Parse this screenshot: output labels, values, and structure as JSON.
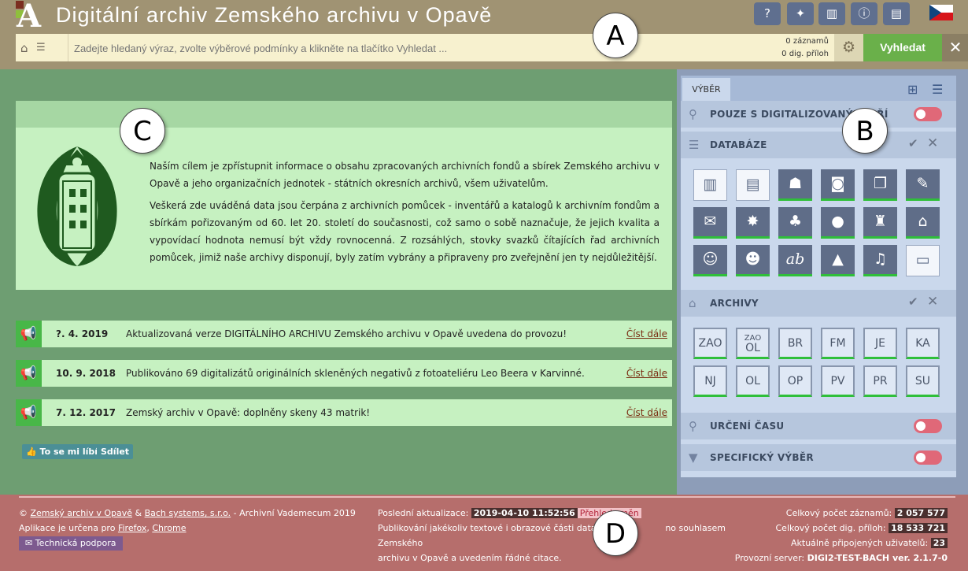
{
  "app": {
    "title": "Digitální archiv Zemského archivu v Opavě",
    "logo_letter": "A"
  },
  "toolbar": {
    "icons": [
      "help-icon",
      "magic-wand-icon",
      "chart-icon",
      "info-icon",
      "print-icon"
    ],
    "language": "cs"
  },
  "search": {
    "placeholder": "Zadejte hledaný výraz, zvolte výběrové podmínky a klikněte na tlačítko Vyhledat ...",
    "records_count": "0 záznamů",
    "attachments_count": "0 dig. příloh",
    "search_label": "Vyhledat"
  },
  "intro": {
    "p1": "Naším cílem je zpřístupnit informace o obsahu zpracovaných archivních fondů a sbírek Zemského archivu v Opavě a jeho organizačních jednotek - státních okresních archivů, všem uživatelům.",
    "p2": "Veškerá zde uváděná data jsou čerpána z archivních pomůcek - inventářů a katalogů k archivním fondům a sbírkám pořizovaným od 60. let 20. století do současnosti, což samo o sobě naznačuje, že jejich kvalita a vypovídací hodnota nemusí být vždy rovnocenná. Z rozsáhlých, stovky svazků čítajících řad archivních pomůcek, jimiž naše archivy disponují, byly zatím vybrány a připraveny pro zveřejnění jen ty nejdůležitější."
  },
  "news": [
    {
      "date": "?. 4. 2019",
      "text": "Aktualizovaná verze DIGITÁLNÍHO ARCHIVU Zemského archivu v Opavě uvedena do provozu!",
      "more": "Číst dále"
    },
    {
      "date": "10. 9. 2018",
      "text": "Publikováno 69 digitalizátů originálních skleněných negativů z fotoateliéru Leo Beera v Karvinné.",
      "more": "Číst dále"
    },
    {
      "date": "7. 12. 2017",
      "text": "Zemský archiv v Opavě: doplněny skeny 43 matrik!",
      "more": "Číst dále"
    }
  ],
  "social": {
    "like": "To se mi líbí",
    "share": "Sdílet"
  },
  "panel": {
    "tab": "VÝBĚR",
    "digitized_only": "POUZE S DIGITALIZOVANÝMI PŘÍ",
    "databases": "DATABÁZE",
    "archives": "ARCHIVY",
    "time": "URČENÍ ČASU",
    "specific": "SPECIFICKÝ VÝBĚR"
  },
  "db_icons": [
    {
      "name": "archive-fonds-icon",
      "glyph": "▥",
      "state": "off",
      "style": "light"
    },
    {
      "name": "inventory-icon",
      "glyph": "▤",
      "state": "off",
      "style": "light"
    },
    {
      "name": "person-reader-icon",
      "glyph": "☗",
      "state": "on",
      "style": "dark"
    },
    {
      "name": "camera-icon",
      "glyph": "◙",
      "state": "on",
      "style": "dark"
    },
    {
      "name": "documents-icon",
      "glyph": "❐",
      "state": "on",
      "style": "dark"
    },
    {
      "name": "feather-icon",
      "glyph": "✎",
      "state": "on",
      "style": "dark"
    },
    {
      "name": "scroll-icon",
      "glyph": "✉",
      "state": "on",
      "style": "dark"
    },
    {
      "name": "star-icon",
      "glyph": "✸",
      "state": "on",
      "style": "dark"
    },
    {
      "name": "tree-icon",
      "glyph": "♣",
      "state": "on",
      "style": "dark"
    },
    {
      "name": "seal-icon",
      "glyph": "●",
      "state": "on",
      "style": "dark"
    },
    {
      "name": "stamp-icon",
      "glyph": "♜",
      "state": "on",
      "style": "dark"
    },
    {
      "name": "house-icon",
      "glyph": "⌂",
      "state": "on",
      "style": "dark"
    },
    {
      "name": "portrait-icon",
      "glyph": "☺",
      "state": "on",
      "style": "dark"
    },
    {
      "name": "people-icon",
      "glyph": "☻",
      "state": "on",
      "style": "dark"
    },
    {
      "name": "handwriting-icon",
      "glyph": "ab",
      "state": "on",
      "style": "dark"
    },
    {
      "name": "map-icon",
      "glyph": "▲",
      "state": "on",
      "style": "dark"
    },
    {
      "name": "film-icon",
      "glyph": "♫",
      "state": "on",
      "style": "dark"
    },
    {
      "name": "book-icon",
      "glyph": "▭",
      "state": "off",
      "style": "light"
    }
  ],
  "archives": [
    {
      "top": "ZAO",
      "bottom": ""
    },
    {
      "top": "ZAO",
      "bottom": "OL"
    },
    {
      "top": "BR",
      "bottom": ""
    },
    {
      "top": "FM",
      "bottom": ""
    },
    {
      "top": "JE",
      "bottom": ""
    },
    {
      "top": "KA",
      "bottom": ""
    },
    {
      "top": "NJ",
      "bottom": ""
    },
    {
      "top": "OL",
      "bottom": ""
    },
    {
      "top": "OP",
      "bottom": ""
    },
    {
      "top": "PV",
      "bottom": ""
    },
    {
      "top": "PR",
      "bottom": ""
    },
    {
      "top": "SU",
      "bottom": ""
    }
  ],
  "footer": {
    "copy": "©",
    "org1": "Zemský archiv v Opavě",
    "amp": "&",
    "org2": "Bach systems, s.r.o.",
    "suffix": "- Archivní Vademecum 2019",
    "browsers_prefix": "Aplikace je určena pro",
    "firefox": "Firefox",
    "chrome": "Chrome",
    "support": "Technická podpora",
    "last_update_label": "Poslední aktualizace:",
    "last_update": "2019-04-10 11:52:56",
    "changes": "Přehled změn",
    "notice_a": "Publikování jakékoliv textové i obrazové části databáze",
    "notice_b": "no souhlasem Zemského",
    "notice_c": "archivu v Opavě a uvedením řádné citace.",
    "total_records_label": "Celkový počet záznamů:",
    "total_records": "2 057 577",
    "total_attachments_label": "Celkový počet dig. příloh:",
    "total_attachments": "18 533 721",
    "users_label": "Aktuálně připojených uživatelů:",
    "users": "23",
    "server_label": "Provozní server:",
    "server": "DIGI2-TEST-BACH ver. 2.1.7-0"
  },
  "markers": {
    "a": "A",
    "b": "B",
    "c": "C",
    "d": "D"
  }
}
